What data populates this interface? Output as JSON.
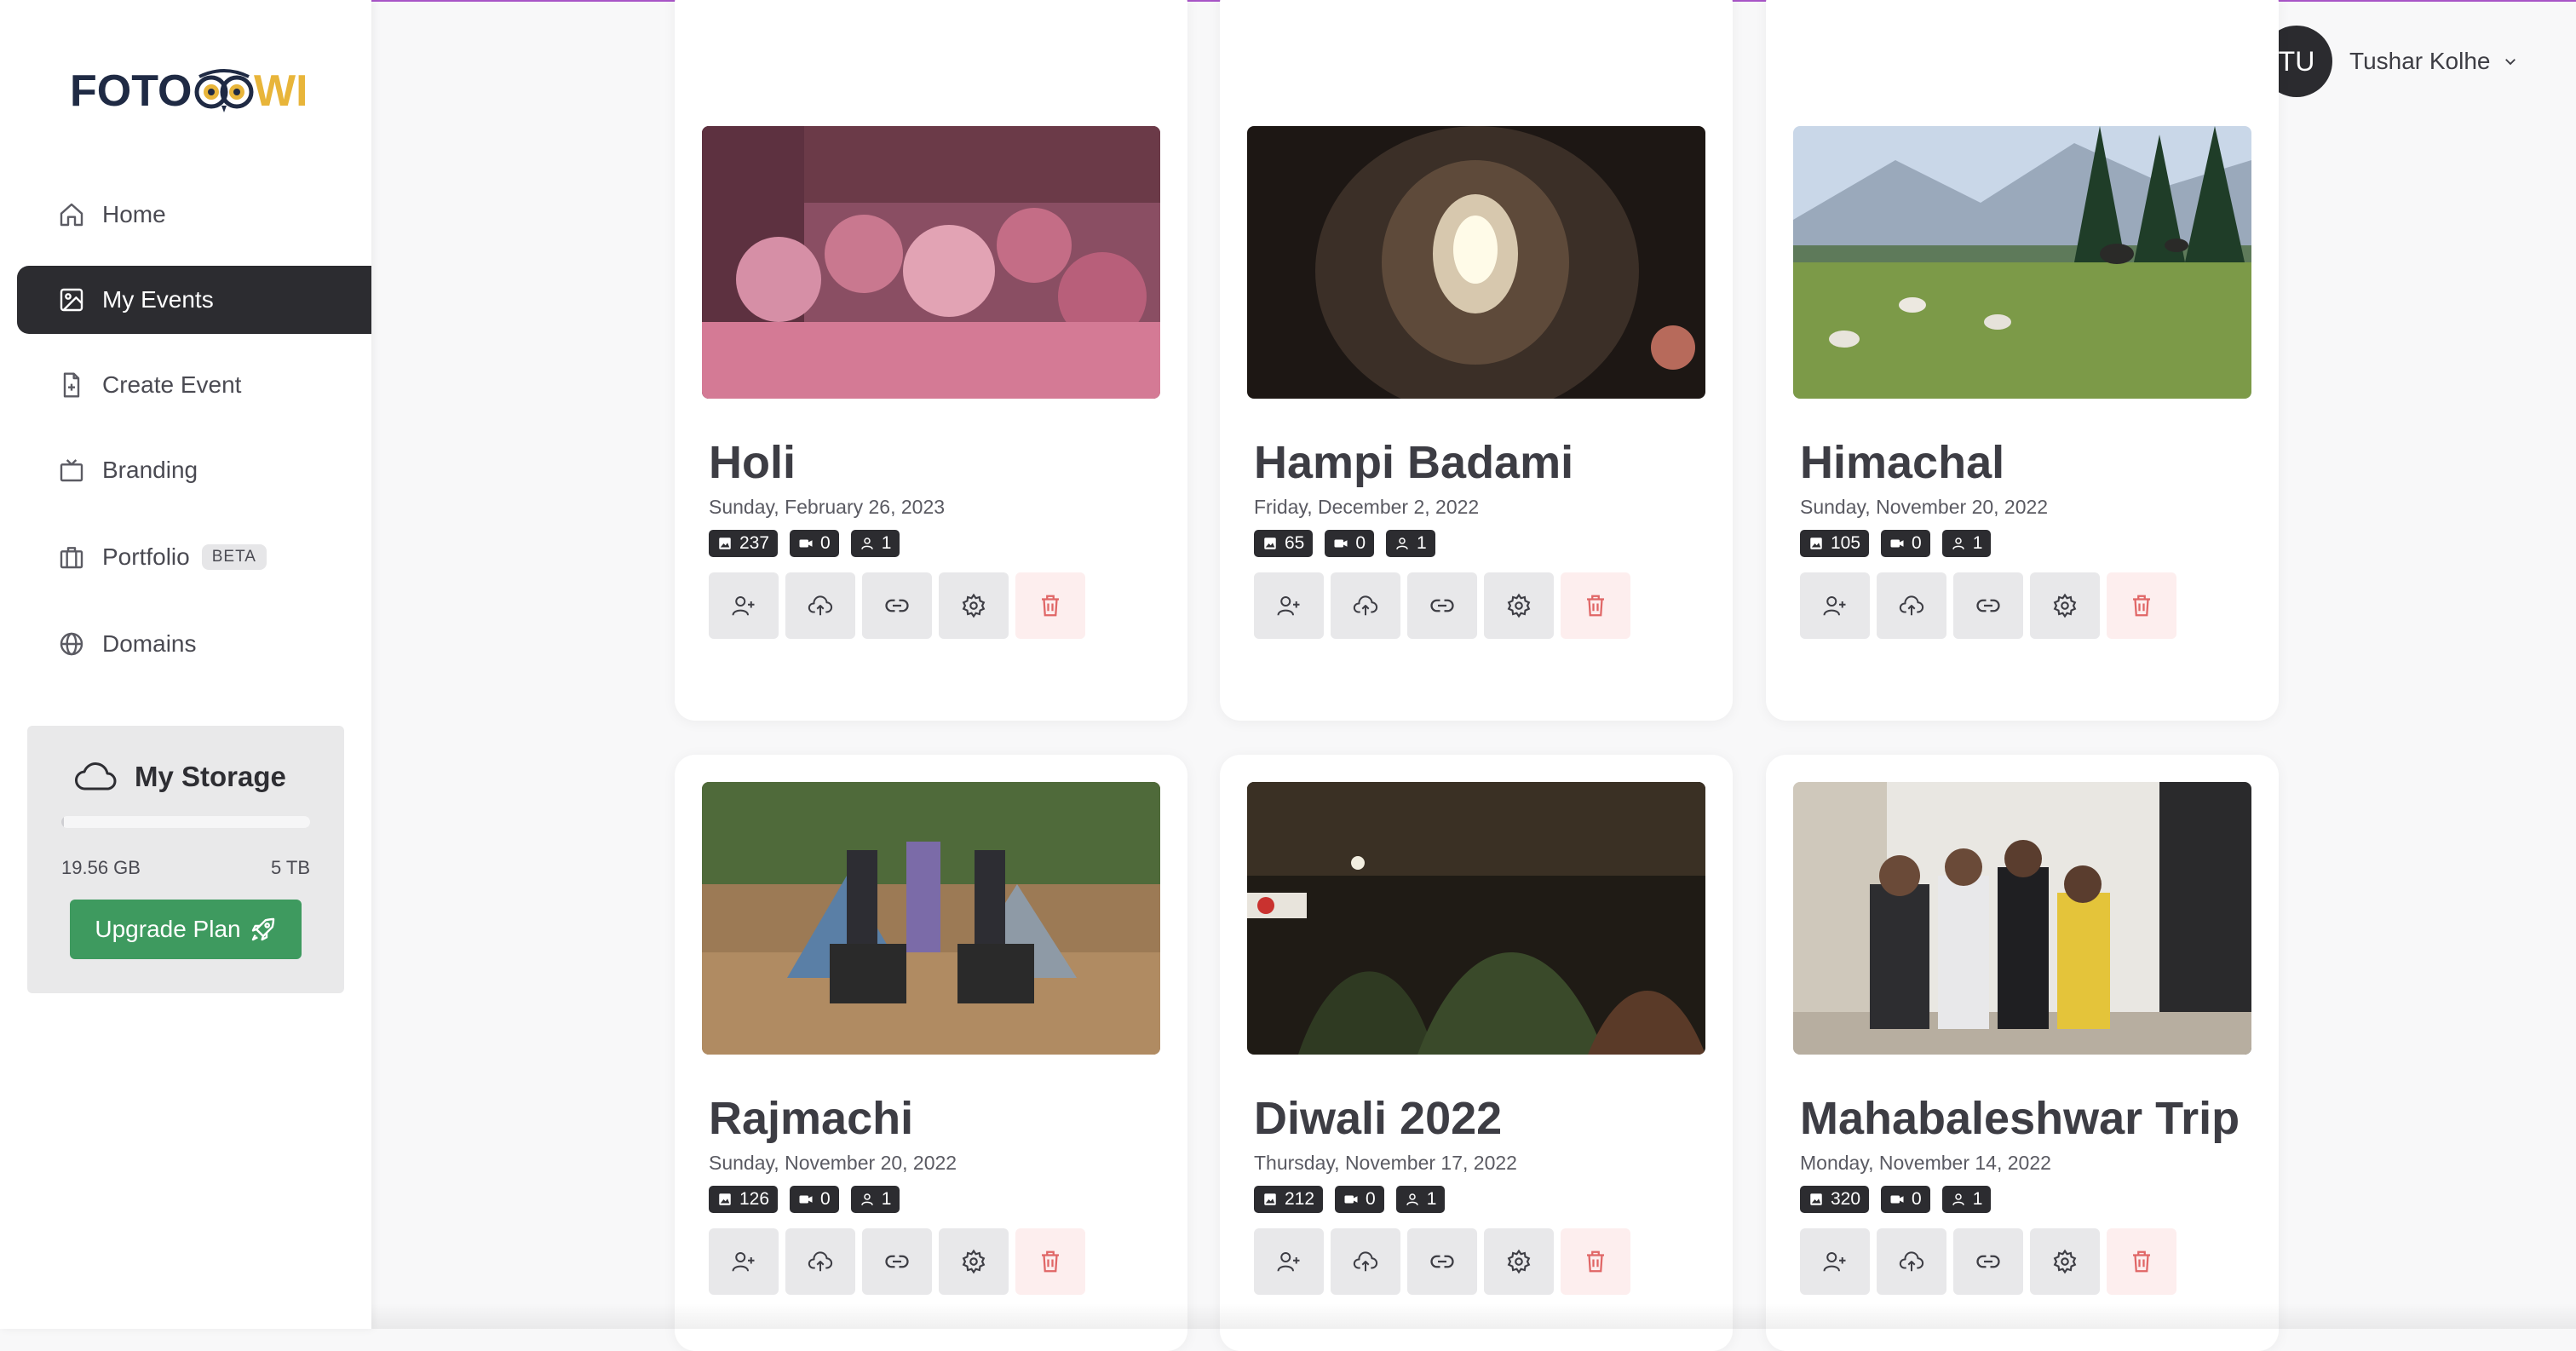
{
  "app": {
    "logo_left": "FOTO",
    "logo_right": "WL",
    "brand_dark": "#1f2a44",
    "brand_accent": "#e8b53a"
  },
  "sidebar": {
    "items": [
      {
        "label": "Home",
        "icon": "home-icon",
        "active": false
      },
      {
        "label": "My Events",
        "icon": "image-icon",
        "active": true
      },
      {
        "label": "Create Event",
        "icon": "file-plus-icon",
        "active": false
      },
      {
        "label": "Branding",
        "icon": "tv-icon",
        "active": false
      },
      {
        "label": "Portfolio",
        "icon": "briefcase-icon",
        "active": false,
        "badge": "BETA"
      },
      {
        "label": "Domains",
        "icon": "globe-icon",
        "active": false
      }
    ],
    "storage": {
      "title": "My Storage",
      "used": "19.56 GB",
      "total": "5 TB",
      "used_fraction": 0.004,
      "upgrade_label": "Upgrade Plan"
    }
  },
  "user": {
    "initials": "TU",
    "name": "Tushar Kolhe"
  },
  "events": [
    {
      "title": "Holi",
      "date": "Sunday, February 26, 2023",
      "photos": "237",
      "videos": "0",
      "users": "1"
    },
    {
      "title": "Hampi Badami",
      "date": "Friday, December 2, 2022",
      "photos": "65",
      "videos": "0",
      "users": "1"
    },
    {
      "title": "Himachal",
      "date": "Sunday, November 20, 2022",
      "photos": "105",
      "videos": "0",
      "users": "1"
    },
    {
      "title": "Rajmachi",
      "date": "Sunday, November 20, 2022",
      "photos": "126",
      "videos": "0",
      "users": "1"
    },
    {
      "title": "Diwali 2022",
      "date": "Thursday, November 17, 2022",
      "photos": "212",
      "videos": "0",
      "users": "1"
    },
    {
      "title": "Mahabaleshwar Trip",
      "date": "Monday, November 14, 2022",
      "photos": "320",
      "videos": "0",
      "users": "1"
    }
  ],
  "colors": {
    "active_nav": "#2c2c30",
    "upgrade": "#3e9a5f",
    "delete_icon": "#e06666",
    "top_line": "#a855c7"
  }
}
